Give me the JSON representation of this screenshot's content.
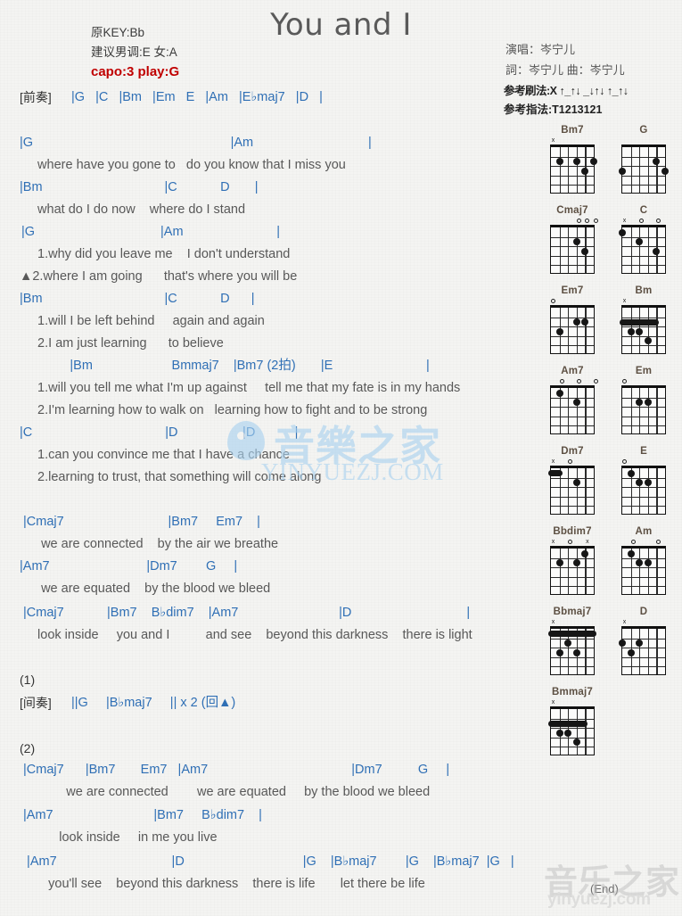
{
  "header": {
    "title": "You and I",
    "original_key": "原KEY:Bb",
    "suggested_key": "建议男调:E 女:A",
    "capo": "capo:3 play:G",
    "singer": "演唱：岑宁儿",
    "credits": "詞：岑宁儿  曲：岑宁儿",
    "strum_pattern": "参考刷法:X ↑_↑↓ _↓↑↓ ↑_↑↓",
    "finger_pattern": "参考指法:T1213121"
  },
  "intro": {
    "label": "[前奏]",
    "chords": "|G   |C   |Bm   |Em   E   |Am   |E♭maj7   |D   |"
  },
  "sections": [
    {
      "chords": "|G                                                       |Am                                |",
      "lyrics": [
        "  where have you gone to   do you know that I miss you"
      ]
    },
    {
      "chords": "|Bm                                  |C            D       |",
      "lyrics": [
        "  what do I do now    where do I stand"
      ]
    },
    {
      "chords": "|G                                   |Am                          |",
      "lyrics": [
        "  1.why did you leave me    I don't understand",
        "▲2.where I am going      that's where you will be"
      ]
    },
    {
      "chords": "|Bm                                  |C            D      |",
      "lyrics": [
        "  1.will I be left behind     again and again",
        "  2.I am just learning      to believe"
      ]
    },
    {
      "chords": "              |Bm                      Bmmaj7    |Bm7 (2拍)       |E                          |",
      "lyrics": [
        "  1.will you tell me what I'm up against     tell me that my fate is in my hands",
        "  2.I'm learning how to walk on   learning how to fight and to be strong"
      ]
    },
    {
      "chords": "|C                                     |D                  |D           |",
      "lyrics": [
        "  1.can you convince me that I have a chance",
        "  2.learning to trust, that something will come along"
      ]
    },
    {
      "chords": " |Cmaj7                             |Bm7     Em7    |",
      "lyrics": [
        "   we are connected    by the air we breathe"
      ]
    },
    {
      "chords": "|Am7                           |Dm7        G     |",
      "lyrics": [
        "   we are equated    by the blood we bleed"
      ]
    },
    {
      "chords": " |Cmaj7            |Bm7    B♭dim7    |Am7                            |D                                |",
      "lyrics": [
        "  look inside     you and I          and see    beyond this darkness    there is light"
      ]
    }
  ],
  "repeat_markers": {
    "first": "(1)",
    "second": "(2)"
  },
  "interlude": {
    "label": "[间奏]",
    "chords": "||G     |B♭maj7     || x 2 (回▲)"
  },
  "sections2": [
    {
      "chords": " |Cmaj7      |Bm7       Em7   |Am7                                        |Dm7          G     |",
      "lyrics": [
        "          we are connected        we are equated     by the blood we bleed"
      ]
    },
    {
      "chords": " |Am7                            |Bm7     B♭dim7    |",
      "lyrics": [
        "        look inside     in me you live"
      ]
    },
    {
      "chords": "  |Am7                                |D                                 |G    |B♭maj7        |G    |B♭maj7  |G   |",
      "lyrics": [
        "     you'll see    beyond this darkness    there is life       let there be life"
      ]
    }
  ],
  "end_tag": "(End)",
  "watermark": {
    "text": "YINYUEZJ.COM",
    "cn": "音樂之家",
    "bottom_cn": "音乐之家",
    "url": "yinyuezj.com"
  },
  "chord_diagrams": [
    {
      "name": "Bm7",
      "markers": [
        "x",
        "",
        "",
        "",
        "",
        ""
      ],
      "dots": [
        [
          2,
          2
        ],
        [
          2,
          4
        ],
        [
          2,
          6
        ],
        [
          3,
          5
        ]
      ],
      "barres": []
    },
    {
      "name": "G",
      "markers": [
        "",
        "",
        "",
        "",
        "",
        ""
      ],
      "dots": [
        [
          2,
          5
        ],
        [
          3,
          6
        ],
        [
          3,
          1
        ]
      ],
      "barres": []
    },
    {
      "name": "Cmaj7",
      "markers": [
        "",
        "",
        "",
        "o",
        "o",
        "o"
      ],
      "dots": [
        [
          2,
          4
        ],
        [
          3,
          5
        ]
      ],
      "barres": []
    },
    {
      "name": "C",
      "markers": [
        "x",
        "",
        "o",
        "",
        "o",
        ""
      ],
      "dots": [
        [
          1,
          1
        ],
        [
          2,
          3
        ],
        [
          3,
          5
        ]
      ],
      "barres": []
    },
    {
      "name": "Em7",
      "markers": [
        "o",
        "",
        "",
        "",
        "",
        ""
      ],
      "dots": [
        [
          2,
          5
        ],
        [
          2,
          4
        ],
        [
          3,
          2
        ]
      ],
      "barres": []
    },
    {
      "name": "Bm",
      "markers": [
        "x",
        "",
        "",
        "",
        "",
        ""
      ],
      "dots": [
        [
          3,
          3
        ],
        [
          3,
          2
        ],
        [
          4,
          4
        ]
      ],
      "barres": [
        [
          2,
          1,
          5
        ]
      ]
    },
    {
      "name": "Am7",
      "markers": [
        "",
        "o",
        "",
        "o",
        "",
        "o"
      ],
      "dots": [
        [
          1,
          2
        ],
        [
          2,
          4
        ]
      ],
      "barres": []
    },
    {
      "name": "Em",
      "markers": [
        "o",
        "",
        "",
        "",
        "",
        ""
      ],
      "dots": [
        [
          2,
          4
        ],
        [
          2,
          3
        ]
      ],
      "barres": []
    },
    {
      "name": "Dm7",
      "markers": [
        "x",
        "",
        "o",
        "",
        "",
        ""
      ],
      "dots": [
        [
          2,
          4
        ]
      ],
      "barres": [
        [
          1,
          1,
          2
        ]
      ]
    },
    {
      "name": "E",
      "markers": [
        "o",
        "",
        "",
        "",
        "",
        ""
      ],
      "dots": [
        [
          1,
          2
        ],
        [
          2,
          4
        ],
        [
          2,
          3
        ]
      ],
      "barres": []
    },
    {
      "name": "Bbdim7",
      "markers": [
        "x",
        "",
        "o",
        "",
        "x",
        ""
      ],
      "dots": [
        [
          1,
          5
        ],
        [
          2,
          4
        ],
        [
          2,
          2
        ]
      ],
      "barres": []
    },
    {
      "name": "Am",
      "markers": [
        "",
        "o",
        "",
        "",
        "o",
        ""
      ],
      "dots": [
        [
          1,
          2
        ],
        [
          2,
          4
        ],
        [
          2,
          3
        ]
      ],
      "barres": []
    },
    {
      "name": "Bbmaj7",
      "markers": [
        "x",
        "",
        "",
        "",
        "",
        ""
      ],
      "dots": [
        [
          2,
          3
        ],
        [
          3,
          4
        ],
        [
          3,
          2
        ]
      ],
      "barres": [
        [
          1,
          1,
          6
        ]
      ]
    },
    {
      "name": "D",
      "markers": [
        "x",
        "",
        "",
        "",
        "",
        ""
      ],
      "dots": [
        [
          2,
          3
        ],
        [
          2,
          1
        ],
        [
          3,
          2
        ]
      ],
      "barres": []
    },
    {
      "name": "Bmmaj7",
      "markers": [
        "x",
        "",
        "",
        "",
        "",
        ""
      ],
      "dots": [
        [
          3,
          3
        ],
        [
          3,
          2
        ],
        [
          4,
          4
        ]
      ],
      "barres": [
        [
          2,
          1,
          5
        ]
      ]
    }
  ],
  "colors": {
    "chord_blue": "#2f6fb5",
    "capo_red": "#c00000",
    "lyric_gray": "#585858",
    "chord_name_brown": "#5d5043"
  }
}
